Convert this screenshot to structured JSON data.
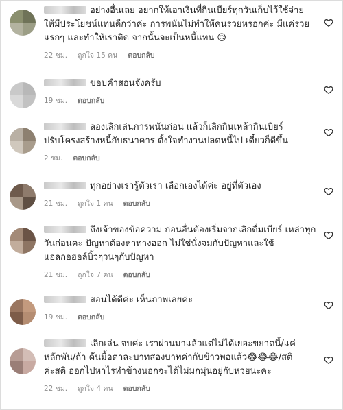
{
  "comments": [
    {
      "lines": [
        "อย่างอื่นเลย อยากให้เอาเงินที่กินเบียร์ทุกวันเก็บไว้ใช้จ่าย",
        "ให้มีประโยชน์แทนดีกว่าค่ะ การพนันไม่ทำให้คนรวยหรอกค่ะ มีแค่รวย",
        "แรกๆ และทำให้เราติด จากนั้นจะเป็นหนี้แทน 😥"
      ],
      "time": "22 ชม.",
      "likes": "ถูกใจ 15 คน",
      "reply": "ตอบกลับ",
      "avatar_colors": [
        "#8a8f6e",
        "#6f7358",
        "#b3b3a0",
        "#9c9e86"
      ]
    },
    {
      "lines": [
        "ขอบคำสอนจังครับ"
      ],
      "time": "19 ชม.",
      "likes": "",
      "reply": "ตอบกลับ",
      "avatar_colors": [
        "#c9c9c9",
        "#b8b8b8",
        "#d9d9d9",
        "#c2c2c2"
      ]
    },
    {
      "lines": [
        "ลองเลิกเล่นการพนันก่อน แล้วก็เลิกกินเหล้ากินเบียร์",
        "ปรับโครงสร้างหนี้กับธนาคาร ตั้งใจทำงานปลดหนี้ไป เดี๋ยวก็ดีขึ้น"
      ],
      "time": "2 ชม.",
      "likes": "",
      "reply": "ตอบกลับ",
      "avatar_colors": [
        "#b9b0a4",
        "#8d8070",
        "#d0c8bd",
        "#a89c8c"
      ]
    },
    {
      "lines": [
        "ทุกอย่างเรารู้ตัวเรา เลือกเองได้ค่ะ อยู่ที่ตัวเอง"
      ],
      "time": "21 ชม.",
      "likes": "ถูกใจ 1 คน",
      "reply": "ตอบกลับ",
      "avatar_colors": [
        "#6e5a4c",
        "#8e7b6c",
        "#a89888",
        "#5f4f43"
      ]
    },
    {
      "lines": [
        "ถึงเจ้าของข้อความ ก่อนอื่นต้องเริ่มจากเลิกดื่มเบียร์ เหล่าทุก",
        "วันก่อนคะ ปัญหาต้องหาทางออก ไม่ใช่นั่งจมกับปัญหาและใช้",
        "แอลกอฮอล์บิ้วๆวนๆกับปัญหา"
      ],
      "time": "21 ชม.",
      "likes": "ถูกใจ 7 คน",
      "reply": "ตอบกลับ",
      "avatar_colors": [
        "#a38a77",
        "#6b5446",
        "#c2ad9c",
        "#8e7563"
      ]
    },
    {
      "lines": [
        "สอนได้ดีค่ะ เห็นภาพเลยค่ะ"
      ],
      "time": "19 ชม.",
      "likes": "",
      "reply": "ตอบกลับ",
      "avatar_colors": [
        "#9a7660",
        "#c39a7e",
        "#7d5c49",
        "#b58d72"
      ]
    },
    {
      "lines": [
        "เลิกเล่น จบค่ะ เราผ่านมาแล้วแต่ไม่ได้เยอะขยาดนี้/แค่",
        "หลักพัน/ถ้า ค้นมื้อตาละบาทสองบาทค่ากับข้าวพอแล้ว😂😂😂/สติ",
        "ค่ะสติ ออกไปหาไรทำข้างนอกจะได้ไม่มกมุ่นอยู่กับหวยนะคะ"
      ],
      "time": "22 ชม.",
      "likes": "ถูกใจ 4 คน",
      "reply": "ตอบกลับ",
      "avatar_colors": [
        "#b79c94",
        "#d3bdb6",
        "#9a7e77",
        "#c8aaa2"
      ]
    }
  ]
}
